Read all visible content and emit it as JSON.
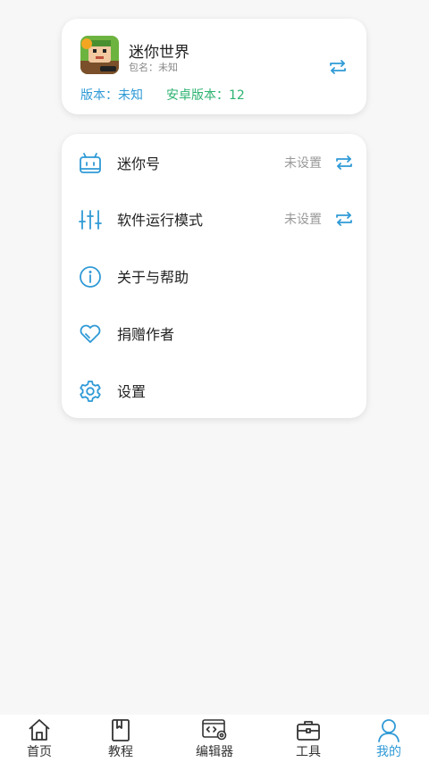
{
  "app": {
    "name": "迷你世界",
    "package": "包名：未知",
    "version": "版本：未知",
    "android_version": "安卓版本：12",
    "icon": "game-icon"
  },
  "menu": [
    {
      "label": "迷你号",
      "value": "未设置",
      "icon": "robot-icon",
      "swap": true
    },
    {
      "label": "软件运行模式",
      "value": "未设置",
      "icon": "sliders-icon",
      "swap": true
    },
    {
      "label": "关于与帮助",
      "value": "",
      "icon": "info-icon",
      "swap": false
    },
    {
      "label": "捐赠作者",
      "value": "",
      "icon": "heart-icon",
      "swap": false
    },
    {
      "label": "设置",
      "value": "",
      "icon": "gear-icon",
      "swap": false
    }
  ],
  "tabs": [
    {
      "label": "首页",
      "icon": "home-icon",
      "active": false
    },
    {
      "label": "教程",
      "icon": "book-icon",
      "active": false
    },
    {
      "label": "编辑器",
      "icon": "editor-icon",
      "active": false
    },
    {
      "label": "工具",
      "icon": "toolbox-icon",
      "active": false
    },
    {
      "label": "我的",
      "icon": "user-icon",
      "active": true
    }
  ],
  "colors": {
    "accent": "#2f9ad6",
    "green": "#2db371",
    "muted": "#999999"
  }
}
